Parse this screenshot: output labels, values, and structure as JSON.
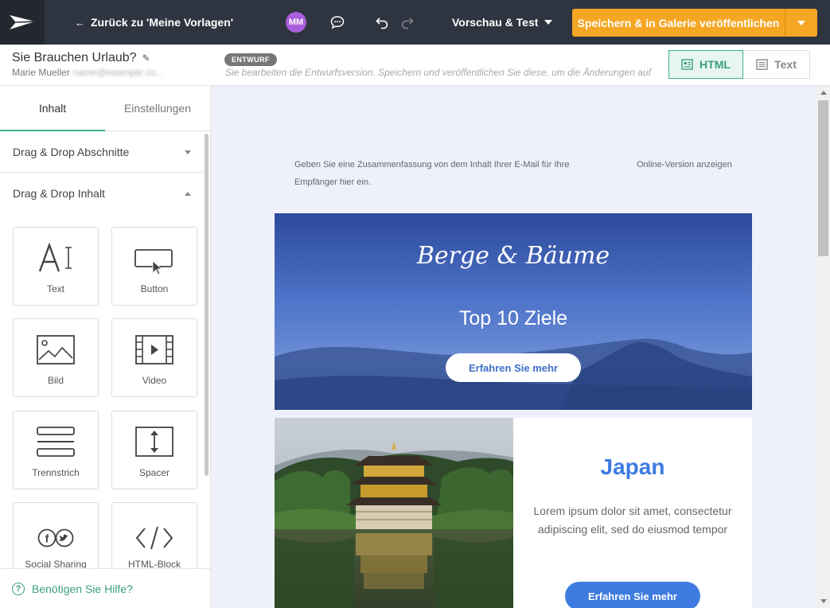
{
  "topbar": {
    "back_label": "Zurück zu 'Meine Vorlagen'",
    "avatar_initials": "MM",
    "preview_label": "Vorschau & Test",
    "save_label": "Speichern & in Galerie veröffentlichen"
  },
  "template": {
    "title": "Sie Brauchen Urlaub?",
    "author": "Marie Mueller",
    "author_email": "name@example.co...",
    "status_badge": "ENTWURF",
    "draft_note": "Sie bearbeiten die Entwurfsversion. Speichern und veröffentlichen Sie diese, um die Änderungen auf li"
  },
  "modes": {
    "html_label": "HTML",
    "text_label": "Text"
  },
  "sidebar": {
    "tabs": [
      "Inhalt",
      "Einstellungen"
    ],
    "sections": {
      "sections_label": "Drag & Drop Abschnitte",
      "content_label": "Drag & Drop Inhalt"
    },
    "blocks": [
      {
        "label": "Text",
        "icon": "text-icon"
      },
      {
        "label": "Button",
        "icon": "button-icon"
      },
      {
        "label": "Bild",
        "icon": "image-icon"
      },
      {
        "label": "Video",
        "icon": "video-icon"
      },
      {
        "label": "Trennstrich",
        "icon": "divider-icon"
      },
      {
        "label": "Spacer",
        "icon": "spacer-icon"
      },
      {
        "label": "Social Sharing",
        "icon": "social-icon"
      },
      {
        "label": "HTML-Block",
        "icon": "code-icon"
      }
    ],
    "help_label": "Benötigen Sie Hilfe?"
  },
  "email": {
    "preheader": "Geben Sie eine Zusammenfassung von dem Inhalt Ihrer E-Mail für Ihre Empfänger hier ein.",
    "online_version": "Online-Version anzeigen",
    "hero": {
      "title": "Berge & Bäume",
      "subtitle": "Top 10 Ziele",
      "button": "Erfahren Sie mehr"
    },
    "card": {
      "title": "Japan",
      "text": "Lorem ipsum dolor sit amet, consectetur adipiscing elit, sed do eiusmod tempor",
      "button": "Erfahren Sie mehr"
    }
  },
  "colors": {
    "topbar": "#2f3540",
    "save": "#f5a623",
    "accent_green": "#3cb489",
    "link_blue": "#3d7be0"
  }
}
